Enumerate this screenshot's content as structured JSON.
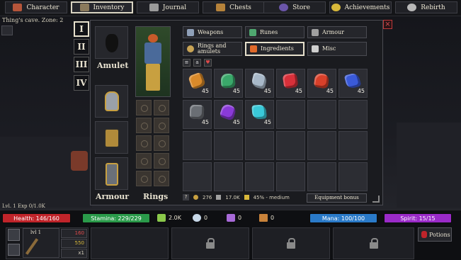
{
  "nav": [
    {
      "label": "Character",
      "icon": "character-icon",
      "color": "#b5553a"
    },
    {
      "label": "Inventory",
      "icon": "backpack-icon",
      "color": "#8a7a5c",
      "active": true
    },
    {
      "label": "Journal",
      "icon": "quill-icon",
      "color": "#9a9a9a"
    },
    {
      "label": "Chests",
      "icon": "chest-icon",
      "color": "#b5823a"
    },
    {
      "label": "Store",
      "icon": "store-icon",
      "color": "#6a55a8"
    },
    {
      "label": "Achievements",
      "icon": "achievement-icon",
      "color": "#d8b83a"
    },
    {
      "label": "Rebirth",
      "icon": "rebirth-icon",
      "color": "#b8b8b8"
    }
  ],
  "world": {
    "zone": "Thing's cave. Zone: 2",
    "level_text": "Lvl. 1 Exp 0/1.0K"
  },
  "inventory": {
    "tabs": [
      "I",
      "II",
      "III",
      "IV"
    ],
    "amulet_label": "Amulet",
    "armour_label": "Armour",
    "rings_label": "Rings",
    "close": "×",
    "categories": [
      {
        "label": "Weapons",
        "icon": "weapon-icon",
        "color": "#8fa0b8"
      },
      {
        "label": "Runes",
        "icon": "rune-icon",
        "color": "#4fa870"
      },
      {
        "label": "Armour",
        "icon": "armour-icon",
        "color": "#a0a0a0"
      },
      {
        "label": "Rings and amulets",
        "icon": "ring-icon",
        "color": "#c9a455"
      },
      {
        "label": "Ingredients",
        "icon": "ingredient-icon",
        "color": "#e06a2a",
        "active": true
      },
      {
        "label": "Misc",
        "icon": "scroll-icon",
        "color": "#cfcfcf"
      }
    ],
    "filters": [
      "a",
      "♥"
    ],
    "items": [
      {
        "name": "amber-ore",
        "color": "#d98a2a",
        "qty": "45"
      },
      {
        "name": "green-ore",
        "color": "#3aa86a",
        "qty": "45"
      },
      {
        "name": "silver-ore",
        "color": "#a8b8c8",
        "qty": "45"
      },
      {
        "name": "red-crystal",
        "color": "#d8303a",
        "qty": "45"
      },
      {
        "name": "red-heart-ore",
        "color": "#d8402a",
        "qty": "45"
      },
      {
        "name": "blue-crystal",
        "color": "#3a5ad8",
        "qty": "45"
      },
      {
        "name": "dark-ore",
        "color": "#6a6e74",
        "qty": "45"
      },
      {
        "name": "violet-star",
        "color": "#8a3ad8",
        "qty": "45"
      },
      {
        "name": "cyan-ore",
        "color": "#3ac8d8",
        "qty": "45"
      }
    ],
    "status": {
      "help": "?",
      "gold": "276",
      "capacity": "17.0K",
      "quality": "45% - medium"
    },
    "equipment_bonus": "Equipment bonus"
  },
  "hud": {
    "health": "Health: 146/160",
    "stamina": "Stamina: 229/229",
    "mana": "Mana: 100/100",
    "spirit": "Spirit: 15/15",
    "resources": [
      {
        "icon": "herb-icon",
        "value": "2.0K",
        "color": "#8ac84a"
      },
      {
        "icon": "orb-icon",
        "value": "0",
        "color": "#c8d8e8"
      },
      {
        "icon": "essence-icon",
        "value": "0",
        "color": "#a86ad8"
      },
      {
        "icon": "crate-icon",
        "value": "0",
        "color": "#c8823a"
      }
    ],
    "weapon": {
      "level": "lvl 1",
      "atk": "160",
      "gold": "550",
      "mult": "x1"
    },
    "potions": "Potions"
  },
  "colors": {
    "health": "#c0242a",
    "stamina": "#2a9a4a",
    "mana": "#2a7ac8",
    "spirit": "#9a2ac8"
  }
}
